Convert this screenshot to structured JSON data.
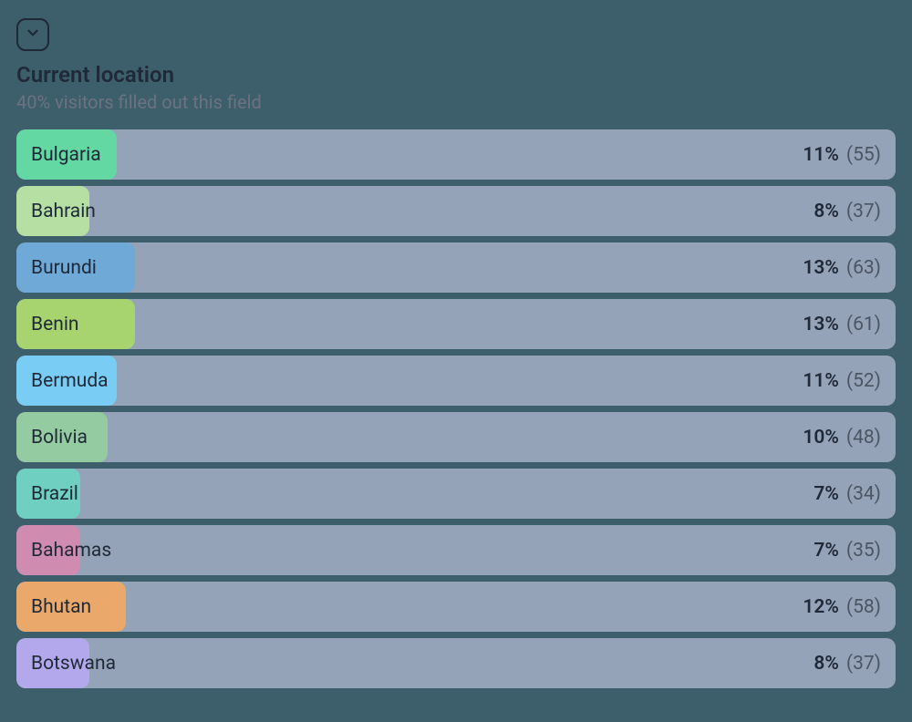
{
  "header": {
    "title": "Current location",
    "subtitle": "40% visitors filled out this field"
  },
  "chart_data": {
    "type": "bar",
    "title": "Current location",
    "subtitle": "40% visitors filled out this field",
    "xlabel": "",
    "ylabel": "",
    "rows": [
      {
        "label": "Bulgaria",
        "percent": 11,
        "count": 55,
        "color": "#63d8a2"
      },
      {
        "label": "Bahrain",
        "percent": 8,
        "count": 37,
        "color": "#b6dfa4"
      },
      {
        "label": "Burundi",
        "percent": 13,
        "count": 63,
        "color": "#6fa9d8"
      },
      {
        "label": "Benin",
        "percent": 13,
        "count": 61,
        "color": "#a8d46f"
      },
      {
        "label": "Bermuda",
        "percent": 11,
        "count": 52,
        "color": "#79cdf4"
      },
      {
        "label": "Bolivia",
        "percent": 10,
        "count": 48,
        "color": "#94cba0"
      },
      {
        "label": "Brazil",
        "percent": 7,
        "count": 34,
        "color": "#6fcfc0"
      },
      {
        "label": "Bahamas",
        "percent": 7,
        "count": 35,
        "color": "#d08bb1"
      },
      {
        "label": "Bhutan",
        "percent": 12,
        "count": 58,
        "color": "#eaa96a"
      },
      {
        "label": "Botswana",
        "percent": 8,
        "count": 37,
        "color": "#b3a8ec"
      }
    ]
  }
}
